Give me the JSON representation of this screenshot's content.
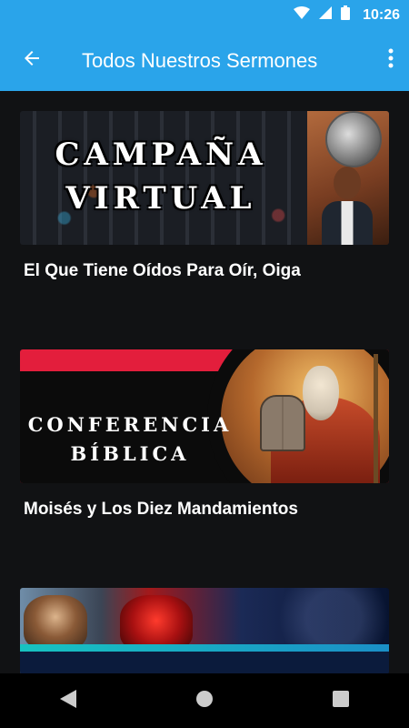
{
  "status_bar": {
    "time": "10:26",
    "icons": [
      "wifi-icon",
      "signal-icon",
      "battery-icon"
    ]
  },
  "toolbar": {
    "title": "Todos Nuestros Sermones",
    "back_icon": "back-arrow-icon",
    "more_icon": "more-vert-icon"
  },
  "sermons": [
    {
      "banner_line1": "CAMPAÑA",
      "banner_line2": "VIRTUAL",
      "title": "El Que Tiene Oídos Para Oír, Oiga"
    },
    {
      "banner_line1": "CONFERENCIA",
      "banner_line2": "BÍBLICA",
      "title": "Moisés y Los Diez Mandamientos"
    },
    {
      "banner_line1": "",
      "banner_line2": "",
      "title": ""
    }
  ],
  "nav_bar": {
    "back": "nav-back-icon",
    "home": "nav-home-icon",
    "recents": "nav-recents-icon"
  },
  "colors": {
    "accent": "#2aa4ea",
    "background": "#111214"
  }
}
